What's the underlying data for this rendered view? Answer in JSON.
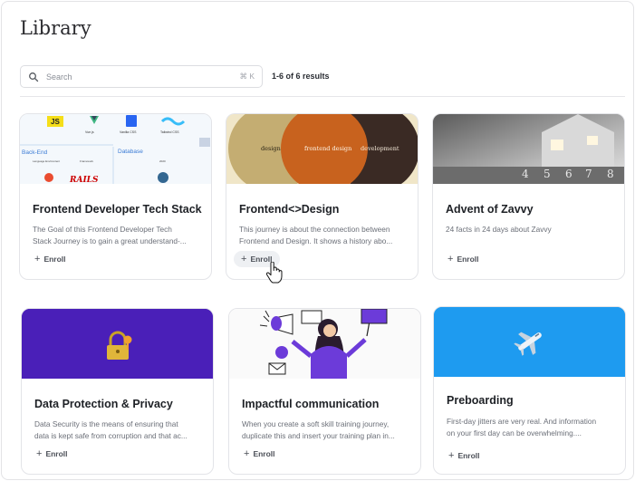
{
  "page": {
    "title": "Library"
  },
  "search": {
    "placeholder": "Search",
    "shortcut": "⌘ K",
    "icon": "search-icon"
  },
  "results_label": "1-6 of 6 results",
  "cards": [
    {
      "title": "Frontend Developer Tech Stack",
      "desc_line1": "The Goal of this Frontend Developer Tech",
      "desc_line2": "Stack Journey is to gain a great understand-...",
      "enroll": "Enroll",
      "thumb": {
        "labels": [
          "JS",
          "Vue.js",
          "Vanilla CSS",
          "Tailwind CSS",
          "Back-End",
          "Language Env/content",
          "Framework",
          "Database",
          "RAILS",
          "2020"
        ]
      }
    },
    {
      "title": "Frontend<>Design",
      "desc_line1": "This journey is about the connection between",
      "desc_line2": "Frontend and Design. It shows a history abo...",
      "enroll": "Enroll",
      "thumb": {
        "circles": [
          "design",
          "frontend design",
          "development"
        ]
      }
    },
    {
      "title": "Advent of Zavvy",
      "desc_line1": "24 facts in 24 days about Zavvy",
      "desc_line2": "",
      "enroll": "Enroll",
      "thumb": {
        "digits": [
          "4",
          "5",
          "6",
          "7",
          "8"
        ]
      }
    },
    {
      "title": "Data Protection & Privacy",
      "desc_line1": "Data Security is the means of ensuring that",
      "desc_line2": "data is kept safe from corruption and that ac...",
      "enroll": "Enroll",
      "thumb": {
        "icon": "padlock-icon",
        "color": "#4a1fb8"
      }
    },
    {
      "title": "Impactful communication",
      "desc_line1": "When you create a soft skill training journey,",
      "desc_line2": "duplicate this and insert your training plan in...",
      "enroll": "Enroll",
      "thumb": {
        "icon": "megaphone-illustration"
      }
    },
    {
      "title": "Preboarding",
      "desc_line1": "First-day jitters are very real. And information",
      "desc_line2": "on your first day can be overwhelming....",
      "enroll": "Enroll",
      "thumb": {
        "icon": "airplane-icon",
        "color": "#1e9bf0"
      }
    }
  ],
  "colors": {
    "accent_purple": "#4a1fb8",
    "accent_blue": "#1e9bf0",
    "orange": "#c8621e"
  }
}
